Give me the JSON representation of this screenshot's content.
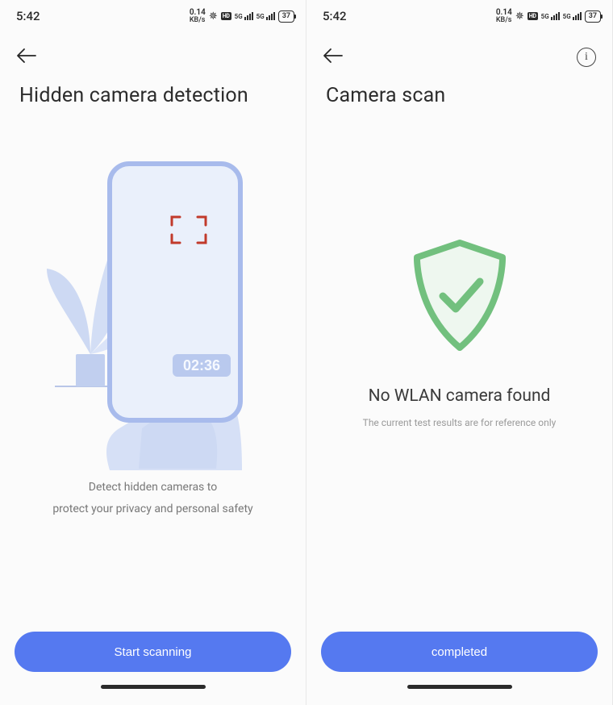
{
  "status": {
    "time": "5:42",
    "kbs_value": "0.14",
    "kbs_label": "KB/s",
    "hd_label": "HD",
    "signal_label": "5G",
    "battery": "37"
  },
  "left": {
    "title": "Hidden camera detection",
    "clock_value": "02:36",
    "caption_line1": "Detect hidden cameras to",
    "caption_line2": "protect your privacy and personal safety",
    "button_label": "Start scanning"
  },
  "right": {
    "title": "Camera scan",
    "result_title": "No WLAN camera found",
    "result_sub": "The current test results are for reference only",
    "button_label": "completed"
  }
}
